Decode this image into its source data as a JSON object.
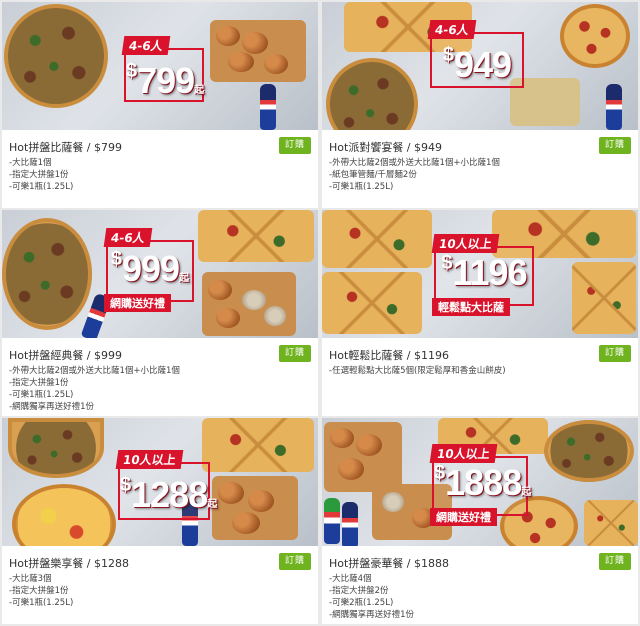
{
  "order_label": "訂購",
  "qi": "起",
  "currency": "$",
  "colors": {
    "order_button": "#6fb31f",
    "badge_red": "#d9132b"
  },
  "cards": [
    {
      "title": "Hot拼盤比薩餐 / $799",
      "items": [
        "-大比薩1個",
        "-指定大拼盤1份",
        "-可樂1瓶(1.25L)"
      ],
      "badge": {
        "tag": "4-6人",
        "price": "799",
        "promo": ""
      }
    },
    {
      "title": "Hot派對饗宴餐 / $949",
      "items": [
        "-外帶大比薩2個或外送大比薩1個+小比薩1個",
        "-紙包筆管麵/千層麵2份",
        "-可樂1瓶(1.25L)"
      ],
      "badge": {
        "tag": "4-6人",
        "price": "949",
        "promo": ""
      }
    },
    {
      "title": "Hot拼盤經典餐 / $999",
      "items": [
        "-外帶大比薩2個或外送大比薩1個+小比薩1個",
        "-指定大拼盤1份",
        "-可樂1瓶(1.25L)",
        "-網購獨享再送好禮1份"
      ],
      "badge": {
        "tag": "4-6人",
        "price": "999",
        "promo": "網購送好禮"
      }
    },
    {
      "title": "Hot輕鬆比薩餐 / $1196",
      "items": [
        "-任選輕鬆點大比薩5個(限定鬆厚和香金山餅皮)"
      ],
      "badge": {
        "tag": "10人以上",
        "price": "1196",
        "promo": "輕鬆點大比薩"
      }
    },
    {
      "title": "Hot拼盤樂享餐 / $1288",
      "items": [
        "-大比薩3個",
        "-指定大拼盤1份",
        "-可樂1瓶(1.25L)"
      ],
      "badge": {
        "tag": "10人以上",
        "price": "1288",
        "promo": ""
      }
    },
    {
      "title": "Hot拼盤豪華餐 / $1888",
      "items": [
        "-大比薩4個",
        "-指定大拼盤2份",
        "-可樂2瓶(1.25L)",
        "-網購獨享再送好禮1份"
      ],
      "badge": {
        "tag": "10人以上",
        "price": "1888",
        "promo": "網購送好禮"
      }
    }
  ]
}
